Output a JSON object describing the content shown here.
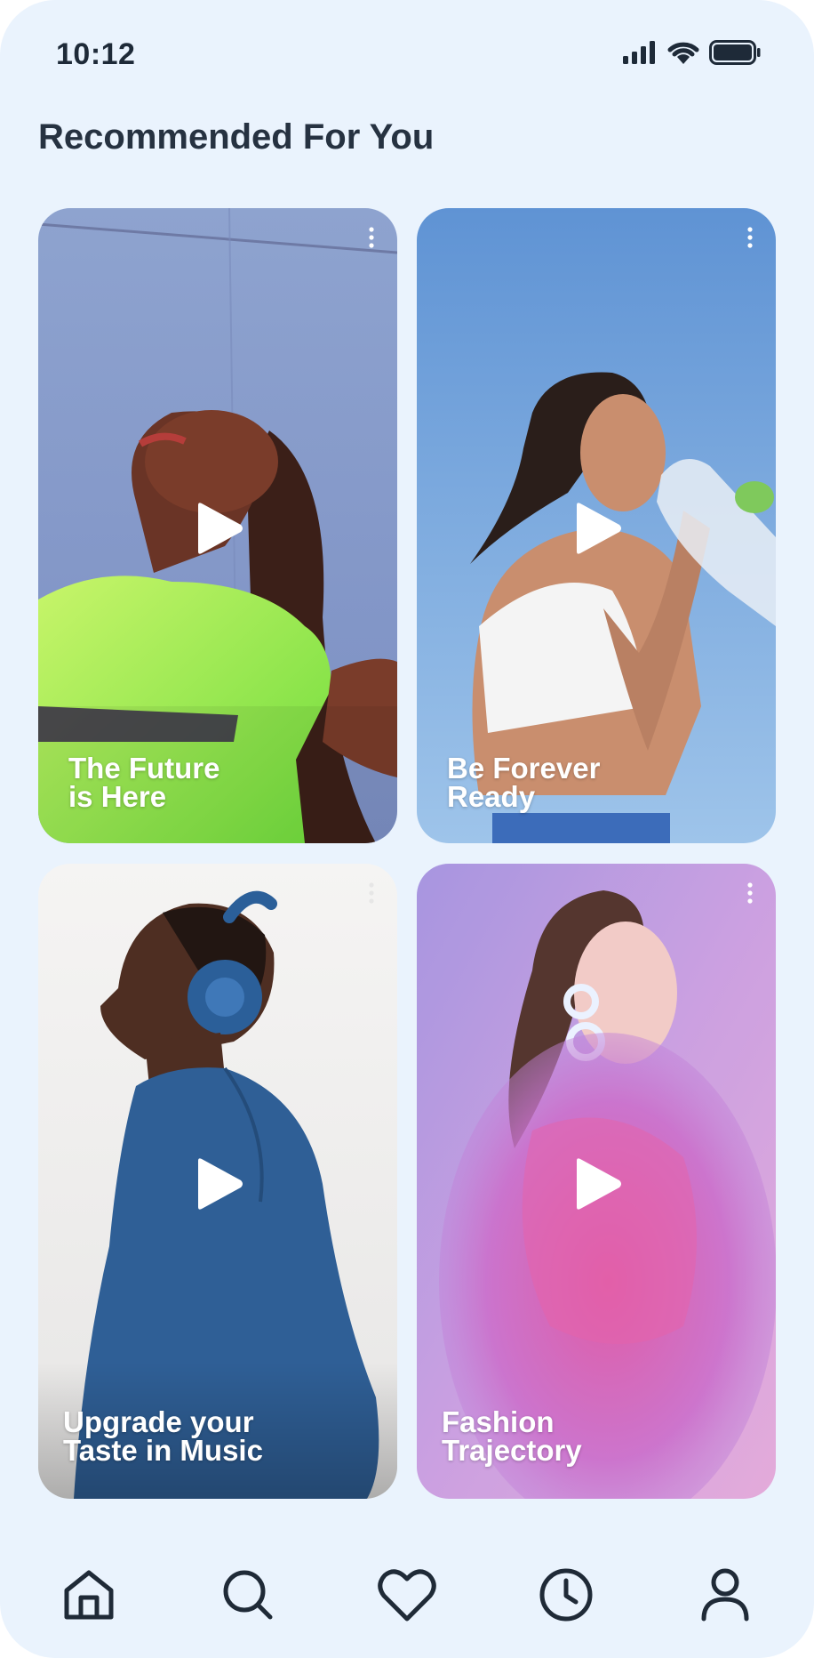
{
  "status_bar": {
    "time": "10:12",
    "icons": [
      "cellular-signal-icon",
      "wifi-icon",
      "battery-icon"
    ]
  },
  "page": {
    "title": "Recommended For You"
  },
  "cards": [
    {
      "title": "The Future\nis Here",
      "icons": [
        "more-vertical-icon",
        "play-icon"
      ]
    },
    {
      "title": "Be Forever\nReady",
      "icons": [
        "more-vertical-icon",
        "play-icon"
      ]
    },
    {
      "title": "Upgrade your\nTaste in Music",
      "icons": [
        "more-vertical-icon",
        "play-icon"
      ]
    },
    {
      "title": "Fashion\nTrajectory",
      "icons": [
        "more-vertical-icon",
        "play-icon"
      ]
    }
  ],
  "bottom_nav": {
    "items": [
      "home-icon",
      "search-icon",
      "heart-icon",
      "history-clock-icon",
      "profile-icon"
    ]
  },
  "colors": {
    "background": "#eaf3fd",
    "text_dark": "#263241",
    "icon_stroke": "#1f2a37"
  }
}
